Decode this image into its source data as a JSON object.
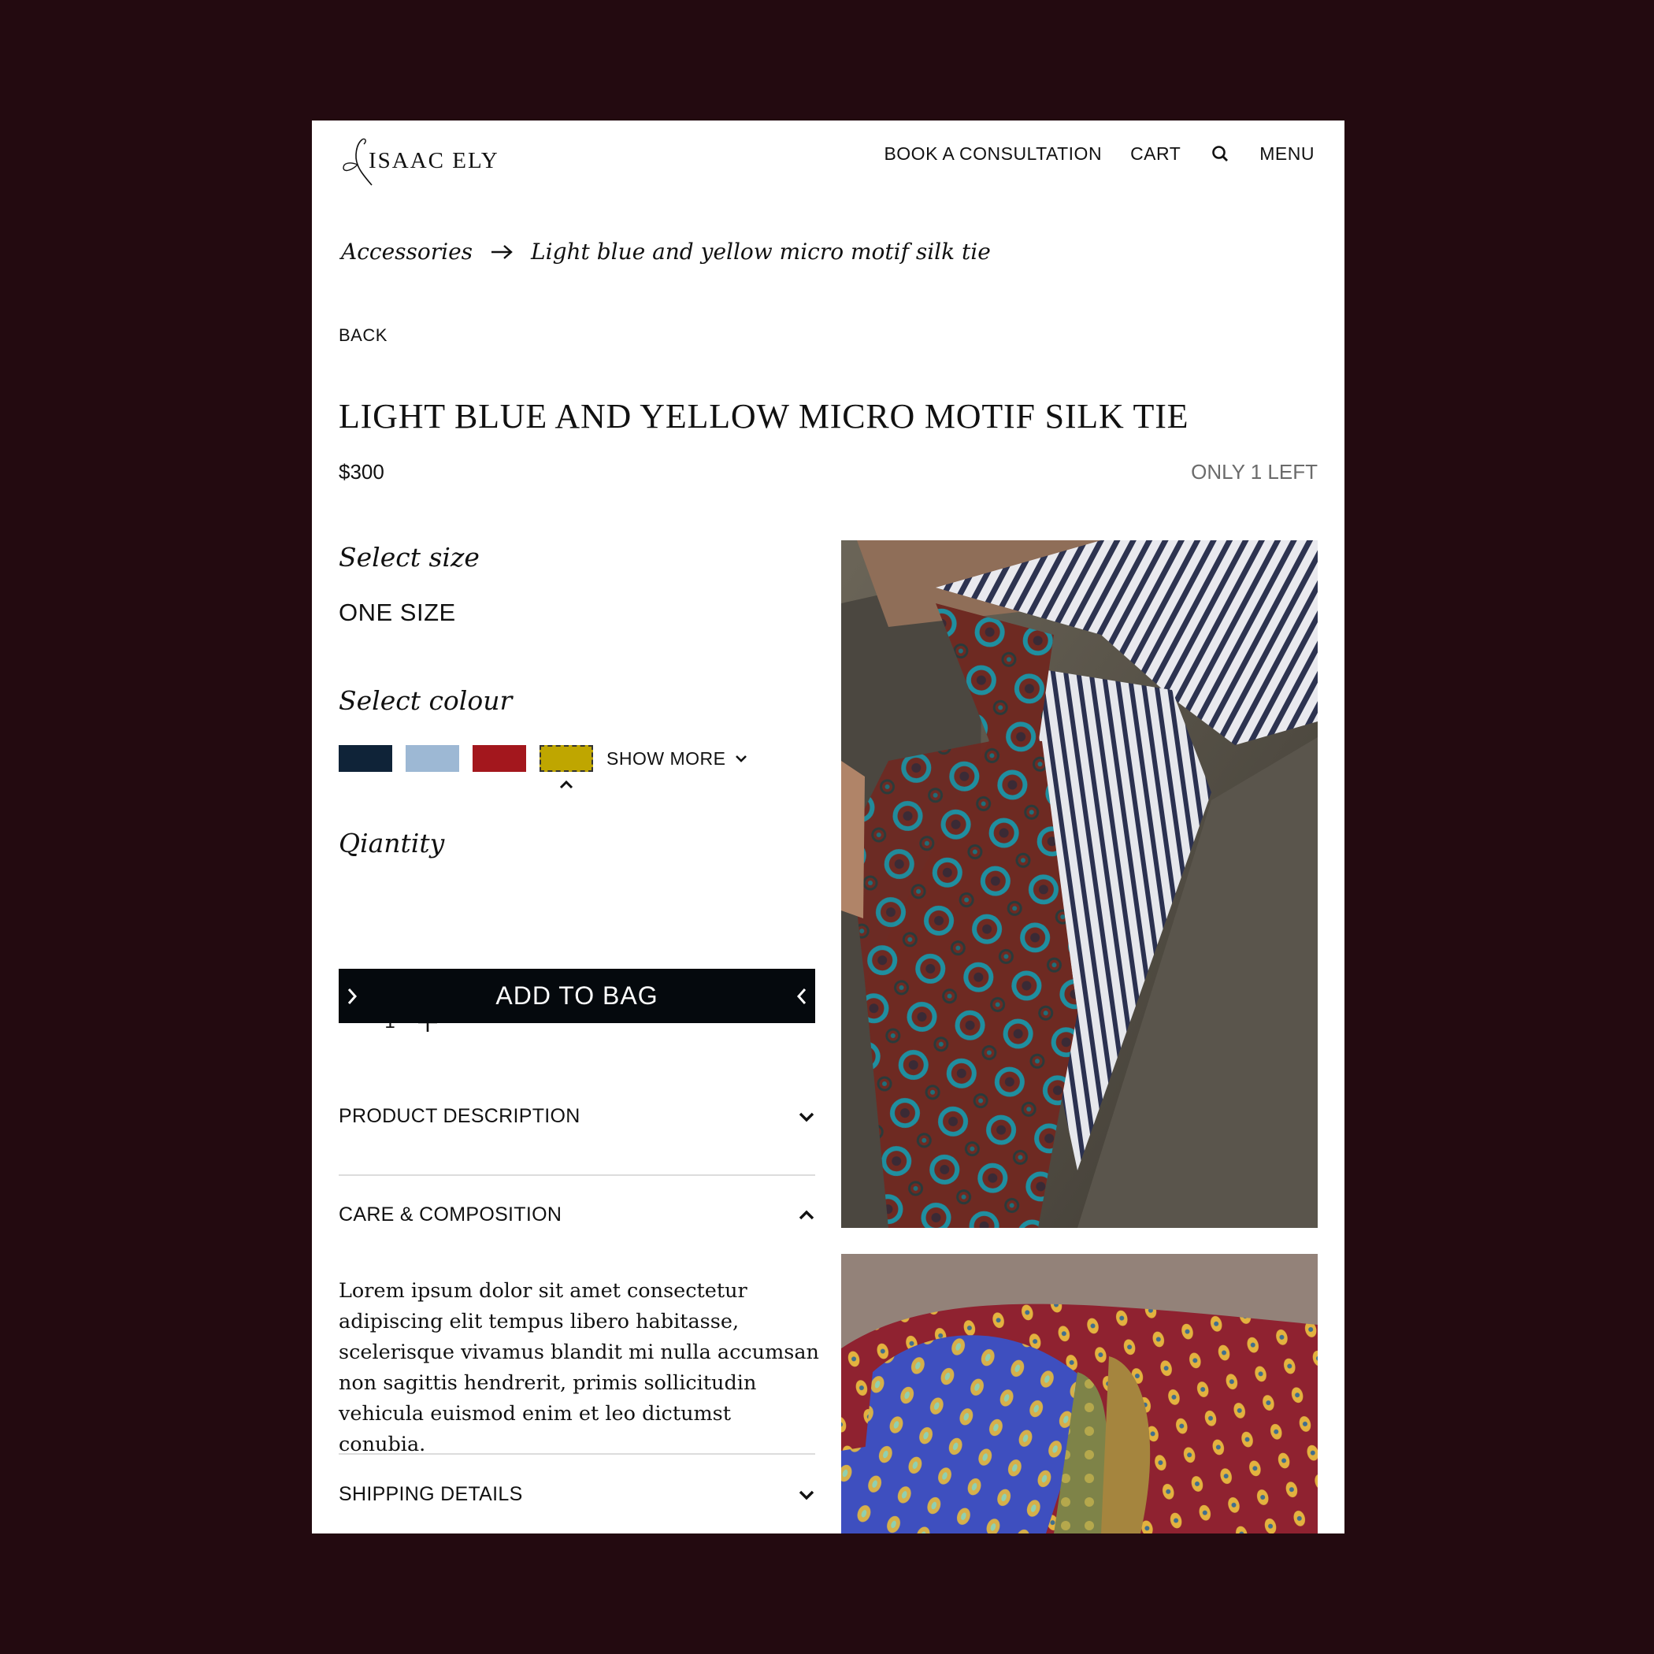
{
  "header": {
    "logo_text": "ISAAC ELY",
    "nav": {
      "consultation": "BOOK A CONSULTATION",
      "cart": "CART",
      "menu": "MENU"
    },
    "search_icon": "search-icon"
  },
  "breadcrumb": {
    "parent": "Accessories",
    "current": "Light blue and yellow micro motif silk tie"
  },
  "back_label": "BACK",
  "product": {
    "title": "LIGHT BLUE AND YELLOW MICRO MOTIF SILK TIE",
    "price": "$300",
    "stock": "ONLY 1 LEFT"
  },
  "size": {
    "label": "Select size",
    "value": "ONE SIZE"
  },
  "colour": {
    "label": "Select colour",
    "swatches": [
      "#0f2338",
      "#9db8d4",
      "#a3171d",
      "#bfa600"
    ],
    "selected_index": 3,
    "show_more": "SHOW MORE"
  },
  "quantity": {
    "label": "Qiantity",
    "value": "1"
  },
  "add_to_bag": "ADD TO BAG",
  "accordion": {
    "description": "PRODUCT DESCRIPTION",
    "care": "CARE & COMPOSITION",
    "care_text": "Lorem ipsum dolor sit amet consectetur adipiscing elit tempus libero habitasse, scelerisque vivamus blandit mi nulla accumsan non sagittis hendrerit, primis sollicitudin vehicula euismod enim et leo dictumst conubia.",
    "shipping": "SHIPPING DETAILS"
  }
}
